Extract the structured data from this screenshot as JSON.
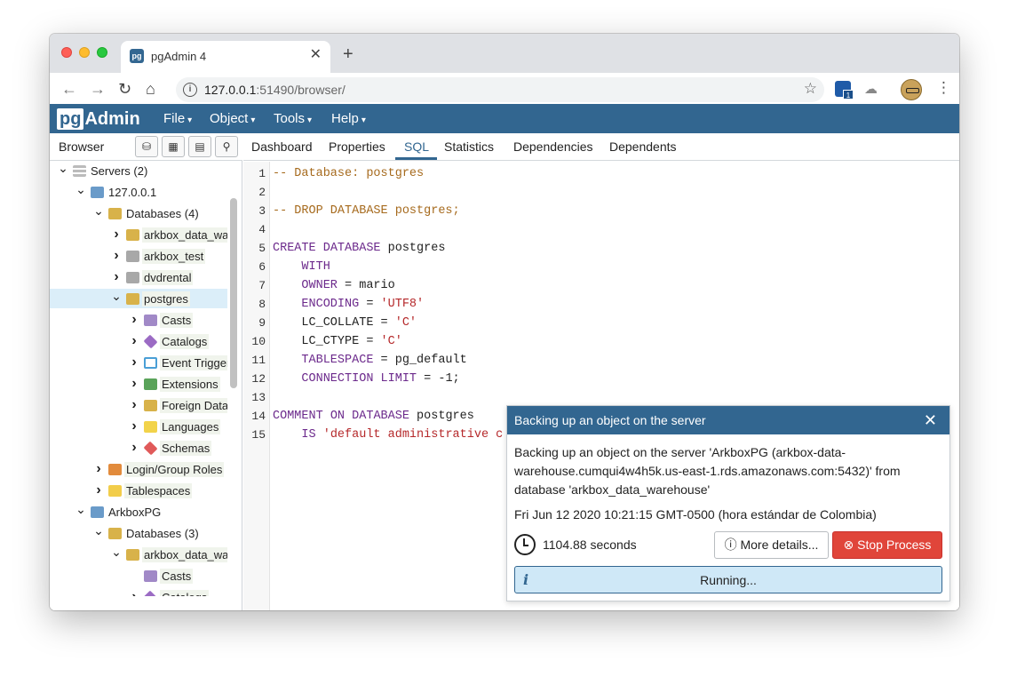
{
  "browser": {
    "tab_title": "pgAdmin 4",
    "tab_favicon": "pg",
    "url_host": "127.0.0.1",
    "url_rest": ":51490/browser/",
    "ext_badge": "1"
  },
  "app": {
    "logo_pg": "pg",
    "logo_admin": "Admin",
    "menus": [
      "File",
      "Object",
      "Tools",
      "Help"
    ]
  },
  "browser_panel": {
    "title": "Browser",
    "tree": [
      {
        "label": "Servers (2)",
        "twisty": "open",
        "icon": "server-icon"
      },
      {
        "label": "127.0.0.1",
        "twisty": "open",
        "icon": "postgres-server-icon"
      },
      {
        "label": "Databases (4)",
        "twisty": "open",
        "icon": "databases-icon"
      },
      {
        "label": "arkbox_data_warehouse",
        "twisty": "closed",
        "icon": "database-icon"
      },
      {
        "label": "arkbox_test",
        "twisty": "closed",
        "icon": "database-disconnected-icon"
      },
      {
        "label": "dvdrental",
        "twisty": "closed",
        "icon": "database-disconnected-icon"
      },
      {
        "label": "postgres",
        "twisty": "open",
        "icon": "database-icon",
        "selected": true
      },
      {
        "label": "Casts",
        "twisty": "closed",
        "icon": "casts-icon"
      },
      {
        "label": "Catalogs",
        "twisty": "closed",
        "icon": "catalogs-icon"
      },
      {
        "label": "Event Triggers",
        "twisty": "closed",
        "icon": "event-triggers-icon"
      },
      {
        "label": "Extensions",
        "twisty": "closed",
        "icon": "extensions-icon"
      },
      {
        "label": "Foreign Data Wrappers",
        "twisty": "closed",
        "icon": "foreign-data-wrappers-icon"
      },
      {
        "label": "Languages",
        "twisty": "closed",
        "icon": "languages-icon"
      },
      {
        "label": "Schemas",
        "twisty": "closed",
        "icon": "schemas-icon"
      },
      {
        "label": "Login/Group Roles",
        "twisty": "closed",
        "icon": "roles-icon"
      },
      {
        "label": "Tablespaces",
        "twisty": "closed",
        "icon": "tablespaces-icon"
      },
      {
        "label": "ArkboxPG",
        "twisty": "open",
        "icon": "postgres-server-icon"
      },
      {
        "label": "Databases (3)",
        "twisty": "open",
        "icon": "databases-icon"
      },
      {
        "label": "arkbox_data_warehouse",
        "twisty": "open",
        "icon": "database-icon"
      },
      {
        "label": "Casts",
        "twisty": "none",
        "icon": "casts-icon"
      },
      {
        "label": "Catalogs",
        "twisty": "closed",
        "icon": "catalogs-icon"
      }
    ]
  },
  "main_tabs": [
    "Dashboard",
    "Properties",
    "SQL",
    "Statistics",
    "Dependencies",
    "Dependents"
  ],
  "active_tab": "SQL",
  "sql_lines": [
    "-- Database: postgres",
    "",
    "-- DROP DATABASE postgres;",
    "",
    "CREATE DATABASE postgres",
    "    WITH",
    "    OWNER = mario",
    "    ENCODING = 'UTF8'",
    "    LC_COLLATE = 'C'",
    "    LC_CTYPE = 'C'",
    "    TABLESPACE = pg_default",
    "    CONNECTION LIMIT = -1;",
    "",
    "COMMENT ON DATABASE postgres",
    "    IS 'default administrative c"
  ],
  "notification": {
    "title": "Backing up an object on the server",
    "message": "Backing up an object on the server 'ArkboxPG (arkbox-data-warehouse.cumqui4w4h5k.us-east-1.rds.amazonaws.com:5432)' from database 'arkbox_data_warehouse'",
    "timestamp": "Fri Jun 12 2020 10:21:15 GMT-0500 (hora estándar de Colombia)",
    "elapsed": "1104.88 seconds",
    "more_details_label": "More details...",
    "stop_label": "Stop Process",
    "status": "Running...",
    "colors": {
      "header": "#326690",
      "stop": "#e0453a",
      "status_bg": "#cfe8f7"
    }
  }
}
